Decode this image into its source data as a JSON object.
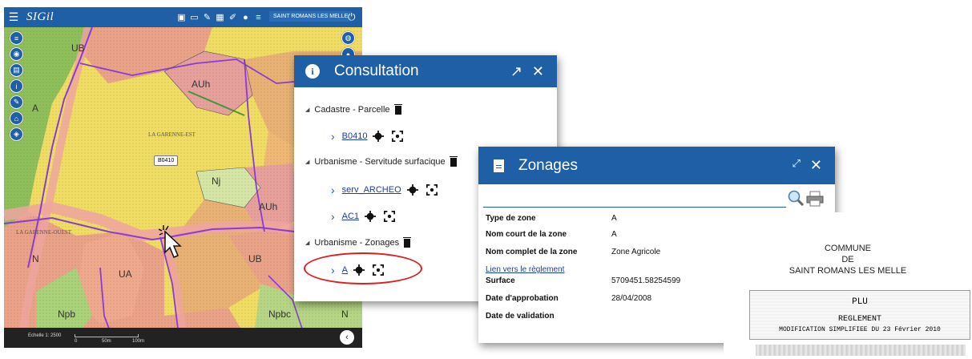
{
  "app": {
    "logo": "SIGil",
    "commune": "SAINT ROMANS LES MELLE",
    "menu_icon": "menu-icon",
    "toolbar_icons": [
      "print-icon",
      "layers-icon",
      "measure-icon",
      "calendar-icon",
      "pen-icon",
      "location-icon",
      "list-icon"
    ],
    "left_tools": [
      "list-icon",
      "locate-icon",
      "document-icon",
      "info-icon",
      "wrench-icon",
      "home-icon",
      "layers-icon"
    ],
    "right_tools": [
      "globe-icon",
      "pin-icon"
    ],
    "colors": {
      "accent": "#1e5fa6"
    }
  },
  "map": {
    "zones": [
      "UB",
      "AUh",
      "A",
      "Nj",
      "AUh",
      "N",
      "UA",
      "UB",
      "Npb",
      "Npbc",
      "UA",
      "N"
    ],
    "place_names": [
      "LA GARENNE-EST",
      "LA GARENNE-OUEST"
    ],
    "parcel_tag": "B0410",
    "scale_label": "Echelle 1: 2500",
    "scale_ticks": [
      "0",
      "50m",
      "100m"
    ]
  },
  "consultation": {
    "title": "Consultation",
    "groups": [
      {
        "label": "Cadastre - Parcelle",
        "items": [
          "B0410"
        ]
      },
      {
        "label": "Urbanisme - Servitude surfacique",
        "items": [
          "serv_ARCHEO",
          "AC1"
        ]
      },
      {
        "label": "Urbanisme - Zonages",
        "items": [
          "A"
        ]
      }
    ]
  },
  "zonages": {
    "title": "Zonages",
    "rows": [
      {
        "label": "Type de zone",
        "value": "A"
      },
      {
        "label": "Nom court de la zone",
        "value": "A"
      },
      {
        "label": "Nom complet de la zone",
        "value": "Zone Agricole"
      }
    ],
    "link": "Lien vers le règlement",
    "rows2": [
      {
        "label": "Surface",
        "value": "5709451.58254599"
      },
      {
        "label": "Date d'approbation",
        "value": "28/04/2008"
      },
      {
        "label": "Date de validation",
        "value": ""
      }
    ]
  },
  "document": {
    "lines": [
      "COMMUNE",
      "DE",
      "SAINT ROMANS LES MELLE"
    ],
    "box_title": "PLU",
    "box_subtitle": "REGLEMENT",
    "box_note": "MODIFICATION SIMPLIFIEE DU 23 Février 2010"
  }
}
